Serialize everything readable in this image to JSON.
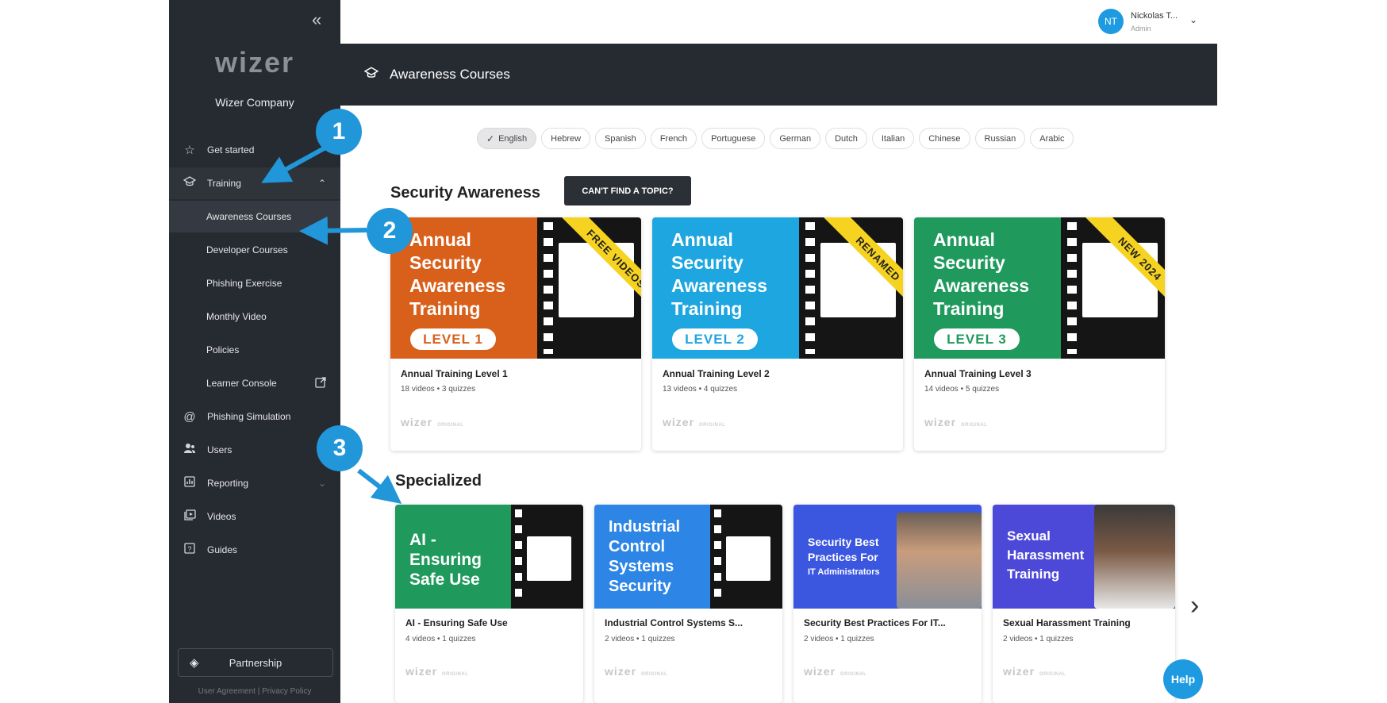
{
  "sidebar": {
    "collapse_icon": "double-chevron-left-icon",
    "logo": "wizer",
    "company": "Wizer Company",
    "items": [
      {
        "label": "Get started",
        "icon": "star-icon"
      },
      {
        "label": "Training",
        "icon": "graduation-cap-icon"
      },
      {
        "label": "Awareness Courses"
      },
      {
        "label": "Developer Courses"
      },
      {
        "label": "Phishing Exercise"
      },
      {
        "label": "Monthly Video"
      },
      {
        "label": "Policies"
      },
      {
        "label": "Learner Console",
        "icon": "external-link-icon"
      },
      {
        "label": "Phishing Simulation",
        "icon": "at-sign-icon"
      },
      {
        "label": "Users",
        "icon": "users-icon"
      },
      {
        "label": "Reporting",
        "icon": "bar-chart-icon"
      },
      {
        "label": "Videos",
        "icon": "video-library-icon"
      },
      {
        "label": "Guides",
        "icon": "help-box-icon"
      }
    ],
    "partnership": "Partnership",
    "footer": "User Agreement | Privacy Policy"
  },
  "topbar": {
    "avatar_initials": "NT",
    "user_name": "Nickolas T...",
    "user_role": "Admin"
  },
  "header": {
    "title": "Awareness Courses"
  },
  "languages": {
    "selected": "English",
    "options": [
      "English",
      "Hebrew",
      "Spanish",
      "French",
      "Portuguese",
      "German",
      "Dutch",
      "Italian",
      "Chinese",
      "Russian",
      "Arabic"
    ]
  },
  "security_section": {
    "title": "Security Awareness",
    "cant_find_button": "CAN'T FIND A TOPIC?",
    "cards": [
      {
        "thumb_text": [
          "Annual",
          "Security",
          "Awareness",
          "Training"
        ],
        "level": "LEVEL 1",
        "ribbon": "FREE VIDEOS",
        "title": "Annual Training Level 1",
        "meta": "18 videos  •  3 quizzes",
        "color": "#d9601a",
        "brand": "wizer",
        "brand_sub": "ORIGINAL"
      },
      {
        "thumb_text": [
          "Annual",
          "Security",
          "Awareness",
          "Training"
        ],
        "level": "LEVEL 2",
        "ribbon": "RENAMED",
        "title": "Annual Training Level 2",
        "meta": "13 videos  •  4 quizzes",
        "color": "#1ea6e0",
        "brand": "wizer",
        "brand_sub": "ORIGINAL"
      },
      {
        "thumb_text": [
          "Annual",
          "Security",
          "Awareness",
          "Training"
        ],
        "level": "LEVEL 3",
        "ribbon": "NEW 2024",
        "title": "Annual Training Level 3",
        "meta": "14 videos  •  5 quizzes",
        "color": "#1f9a5c",
        "brand": "wizer",
        "brand_sub": "ORIGINAL"
      }
    ]
  },
  "specialized_section": {
    "title": "Specialized",
    "cards": [
      {
        "thumb_text": [
          "AI -",
          "Ensuring",
          "Safe Use"
        ],
        "title": "AI - Ensuring Safe Use",
        "meta": "4 videos  •  1 quizzes",
        "color": "#1f9a5c",
        "brand": "wizer",
        "brand_sub": "ORIGINAL"
      },
      {
        "thumb_text": [
          "Industrial",
          "Control",
          "Systems",
          "Security"
        ],
        "title": "Industrial Control Systems S...",
        "meta": "2 videos  •  1 quizzes",
        "color": "#2d86e6",
        "brand": "wizer",
        "brand_sub": "ORIGINAL"
      },
      {
        "thumb_text": [
          "Security Best",
          "Practices For",
          "IT Administrators"
        ],
        "title": "Security Best Practices For IT...",
        "meta": "2 videos  •  1 quizzes",
        "color": "#3b57e0",
        "brand": "wizer",
        "brand_sub": "ORIGINAL"
      },
      {
        "thumb_text": [
          "Sexual",
          "Harassment",
          "Training"
        ],
        "title": "Sexual Harassment Training",
        "meta": "2 videos  •  1 quizzes",
        "color": "#4d49d8",
        "brand": "wizer",
        "brand_sub": "ORIGINAL"
      }
    ]
  },
  "help_button": "Help",
  "callouts": [
    "1",
    "2",
    "3"
  ],
  "colors": {
    "sidebar_bg": "#262a31",
    "accent": "#2196d9"
  }
}
